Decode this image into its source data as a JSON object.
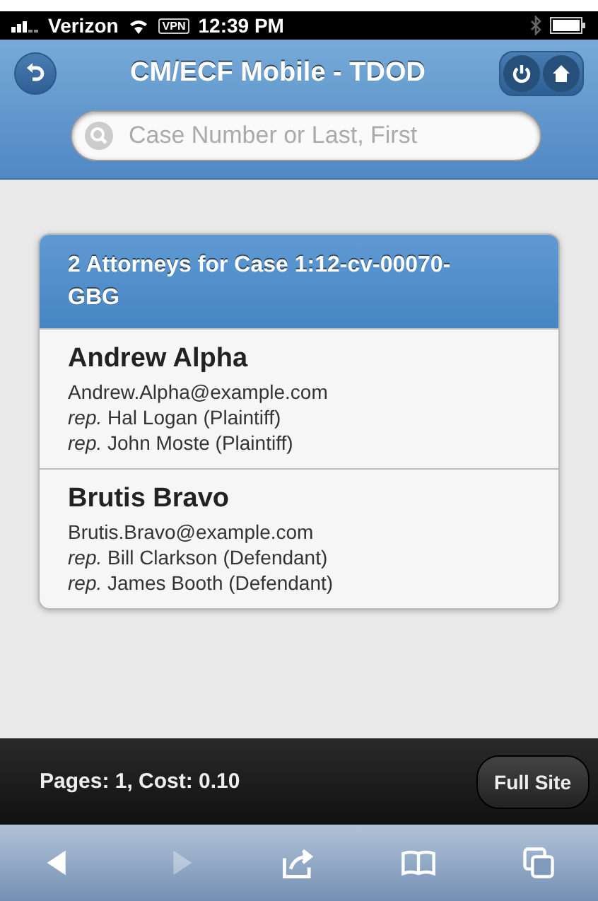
{
  "status_bar": {
    "carrier": "Verizon",
    "vpn": "VPN",
    "time": "12:39 PM"
  },
  "header": {
    "title": "CM/ECF Mobile - TDOD"
  },
  "search": {
    "placeholder": "Case Number or Last, First"
  },
  "card": {
    "title": "2 Attorneys for Case 1:12-cv-00070-GBG",
    "attorneys": [
      {
        "name": "Andrew Alpha",
        "email": "Andrew.Alpha@example.com",
        "reps": [
          "*rep.* Hal Logan (Plaintiff)",
          "*rep.* John Moste (Plaintiff)"
        ]
      },
      {
        "name": "Brutis Bravo",
        "email": "Brutis.Bravo@example.com",
        "reps": [
          "*rep.* Bill Clarkson (Defendant)",
          "*rep.* James Booth (Defendant)"
        ]
      }
    ]
  },
  "footer": {
    "info": "Pages: 1, Cost: 0.10",
    "button": "Full Site"
  },
  "browser_toolbar": [
    {
      "kind": "back",
      "disabled": false
    },
    {
      "kind": "forward",
      "disabled": true
    },
    {
      "kind": "share",
      "disabled": false
    },
    {
      "kind": "bookmarks",
      "disabled": false
    },
    {
      "kind": "tabs",
      "disabled": false
    }
  ]
}
